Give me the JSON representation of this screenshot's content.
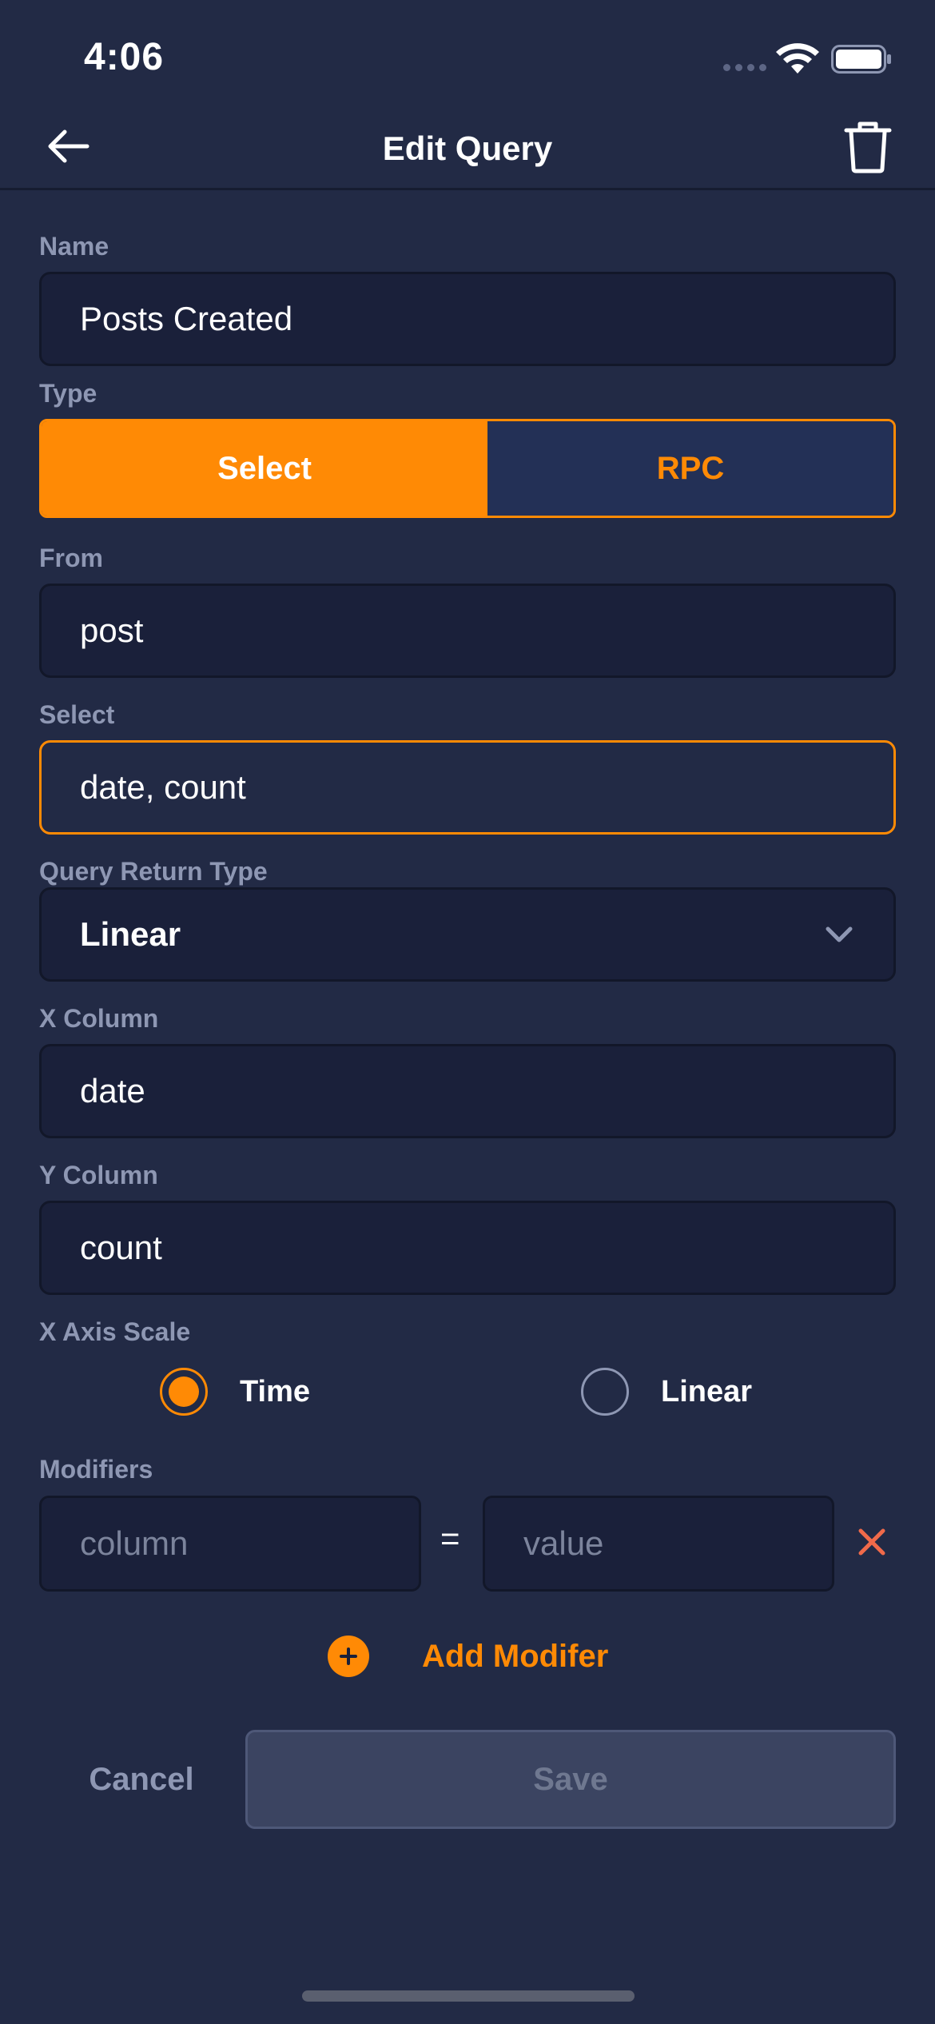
{
  "status_bar": {
    "time": "4:06",
    "wifi_icon": "wifi-icon",
    "battery_icon": "battery-icon",
    "signal_icon": "signal-dots-icon"
  },
  "nav": {
    "title": "Edit Query",
    "back_icon": "arrow-left-icon",
    "delete_icon": "trash-icon"
  },
  "form": {
    "name": {
      "label": "Name",
      "value": "Posts Created"
    },
    "type": {
      "label": "Type",
      "options": [
        "Select",
        "RPC"
      ],
      "selected": "Select"
    },
    "from": {
      "label": "From",
      "value": "post"
    },
    "select": {
      "label": "Select",
      "value": "date, count"
    },
    "return_type": {
      "label": "Query Return Type",
      "value": "Linear",
      "icon": "chevron-down-icon"
    },
    "x_column": {
      "label": "X Column",
      "value": "date"
    },
    "y_column": {
      "label": "Y Column",
      "value": "count"
    },
    "x_axis_scale": {
      "label": "X Axis Scale",
      "options": [
        "Time",
        "Linear"
      ],
      "selected": "Time"
    },
    "modifiers": {
      "label": "Modifiers",
      "column_placeholder": "column",
      "equals": "=",
      "value_placeholder": "value",
      "remove_icon": "close-icon",
      "add_label": "Add Modifer",
      "add_icon": "plus-circle-icon"
    }
  },
  "actions": {
    "cancel": "Cancel",
    "save": "Save"
  },
  "colors": {
    "background": "#222a45",
    "field_background": "#1a203a",
    "accent": "#ff8a05",
    "label": "#8e97b3",
    "remove": "#f06a4a",
    "save_disabled": "#3b4461"
  }
}
